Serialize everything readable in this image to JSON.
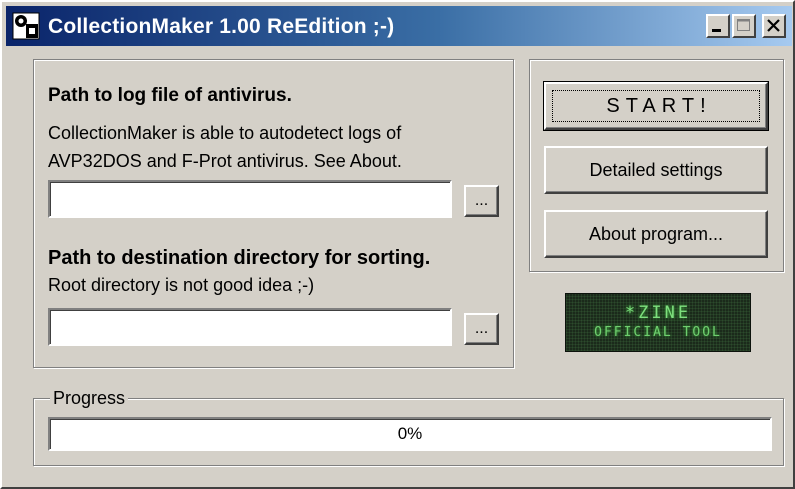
{
  "window": {
    "title": "CollectionMaker 1.00 ReEdition ;-)"
  },
  "log": {
    "heading": "Path to log file of antivirus.",
    "desc_line1": "CollectionMaker is able to autodetect logs of",
    "desc_line2": "AVP32DOS and F-Prot antivirus. See About.",
    "path_value": "",
    "browse_label": "..."
  },
  "dest": {
    "heading": "Path to destination directory for sorting.",
    "desc": "Root directory is not good idea ;-)",
    "path_value": "",
    "browse_label": "..."
  },
  "actions": {
    "start_label": "START!",
    "settings_label": "Detailed settings",
    "about_label": "About program..."
  },
  "logo": {
    "line1": "*ZINE",
    "line2": "OFFICIAL TOOL"
  },
  "progress": {
    "legend": "Progress",
    "value": 0,
    "text": "0%"
  }
}
